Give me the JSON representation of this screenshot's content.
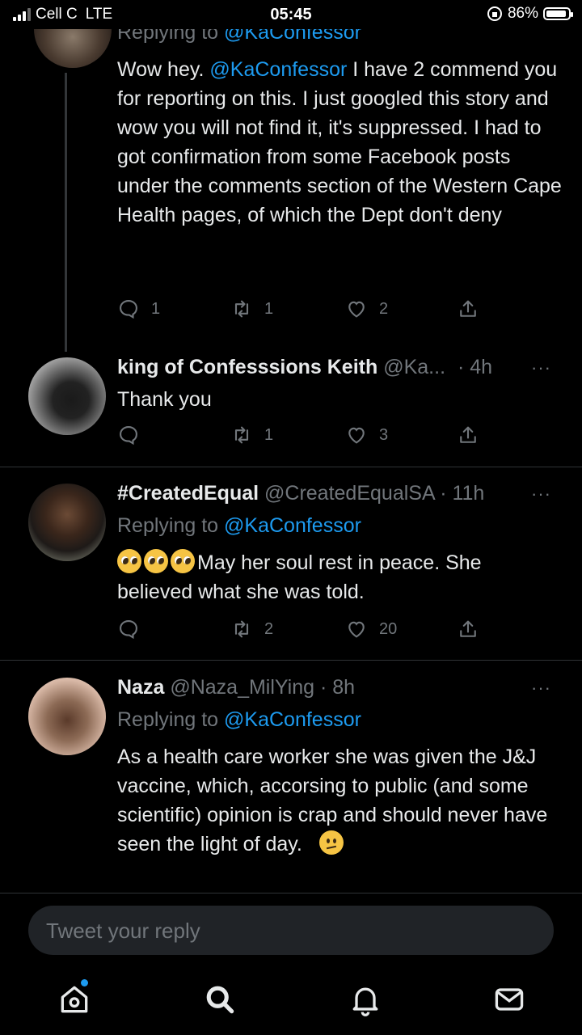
{
  "status_bar": {
    "carrier": "Cell C",
    "network": "LTE",
    "time": "05:45",
    "battery": "86%"
  },
  "tweets": [
    {
      "replying_prefix": "Replying to ",
      "replying_handle": "@KaConfessor",
      "text_before": "Wow hey. ",
      "mention": "@KaConfessor",
      "text_after": "  I have 2 commend you for reporting on this. I just googled this story and wow you will not find it, it's suppressed. I had to got confirmation from some Facebook posts under the comments section of the Western Cape Health pages, of which the Dept don't deny",
      "reply_count": "1",
      "retweet_count": "1",
      "like_count": "2"
    },
    {
      "name": "king of Confesssions Keith",
      "handle": "@Ka...",
      "time": "· 4h",
      "text": "Thank you",
      "reply_count": "",
      "retweet_count": "1",
      "like_count": "3"
    },
    {
      "name": "#CreatedEqual",
      "handle": "@CreatedEqualSA",
      "time": "· 11h",
      "replying_prefix": "Replying to ",
      "replying_handle": "@KaConfessor",
      "text": "May her soul rest in peace. She believed what she was told.",
      "reply_count": "",
      "retweet_count": "2",
      "like_count": "20"
    },
    {
      "name": "Naza",
      "handle": "@Naza_MilYing",
      "time": "· 8h",
      "replying_prefix": "Replying to ",
      "replying_handle": "@KaConfessor",
      "text": "As a health care worker she was given the J&J vaccine, which, accorsing to public (and some scientific) opinion is crap and should never have seen the light of day."
    }
  ],
  "more_label": "···",
  "reply_bar": {
    "placeholder": "Tweet your reply"
  },
  "colors": {
    "accent": "#1d9bf0",
    "muted": "#71767b",
    "background": "#000000",
    "text": "#e7e9ea"
  },
  "tab_bar": {
    "icons": [
      "home-icon",
      "search-icon",
      "notifications-icon",
      "messages-icon"
    ]
  }
}
